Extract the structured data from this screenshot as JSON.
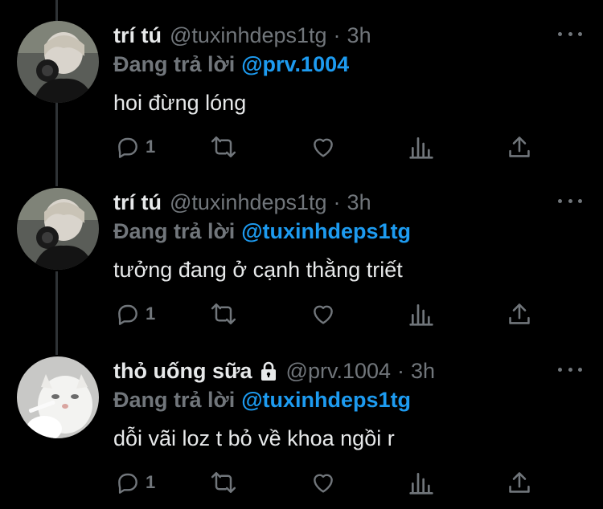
{
  "tweets": [
    {
      "name": "trí tú",
      "handle": "@tuxinhdeps1tg",
      "dot": "·",
      "time": "3h",
      "reply_prefix": "Đang trả lời",
      "reply_handle": "@prv.1004",
      "text": "hoi đừng lóng",
      "reply_count": "1",
      "locked": false,
      "avatar": "avatar-photo"
    },
    {
      "name": "trí tú",
      "handle": "@tuxinhdeps1tg",
      "dot": "·",
      "time": "3h",
      "reply_prefix": "Đang trả lời",
      "reply_handle": "@tuxinhdeps1tg",
      "text": "tưởng đang ở cạnh thằng triết",
      "reply_count": "1",
      "locked": false,
      "avatar": "avatar-photo"
    },
    {
      "name": "thỏ uống sữa",
      "handle": "@prv.1004",
      "dot": "·",
      "time": "3h",
      "reply_prefix": "Đang trả lời",
      "reply_handle": "@tuxinhdeps1tg",
      "text": "dỗi vãi loz t bỏ về khoa ngồi r",
      "reply_count": "1",
      "locked": true,
      "avatar": "cat-photo"
    }
  ],
  "icons": {
    "reply": "reply-icon",
    "retweet": "retweet-icon",
    "like": "heart-icon",
    "analytics": "analytics-icon",
    "share": "share-icon",
    "more": "more-icon",
    "lock": "lock-icon"
  },
  "colors": {
    "background": "#000000",
    "primary_text": "#e7e9ea",
    "secondary_text": "#71767b",
    "accent": "#1d9bf0",
    "thread_line": "#2f3336"
  }
}
